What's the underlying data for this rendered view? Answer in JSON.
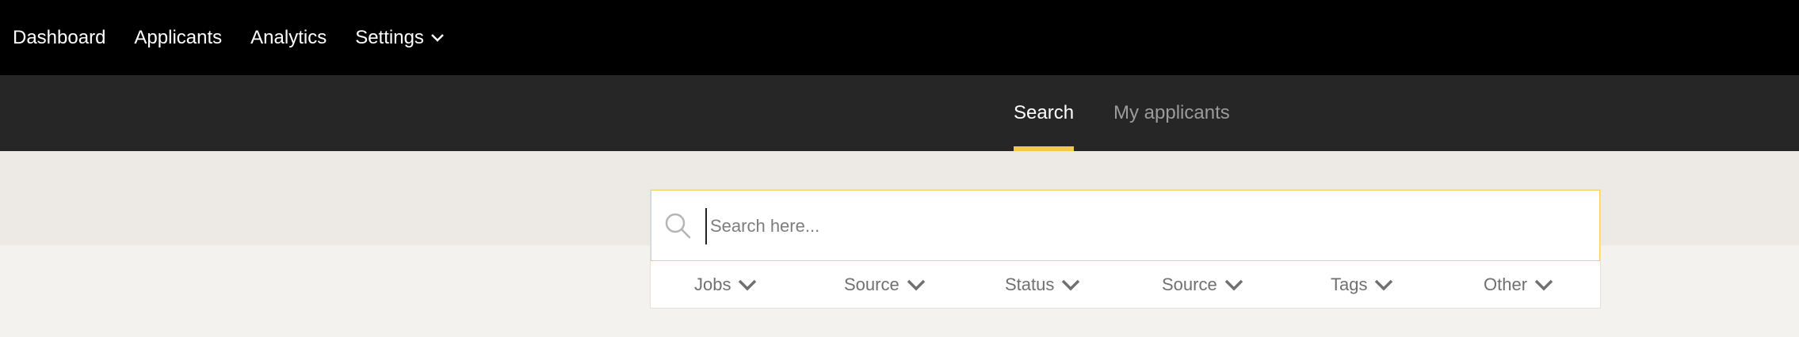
{
  "topnav": {
    "items": [
      {
        "label": "Dashboard"
      },
      {
        "label": "Applicants"
      },
      {
        "label": "Analytics"
      },
      {
        "label": "Settings",
        "icon": "chevron-down-icon"
      }
    ]
  },
  "subnav": {
    "tabs": [
      {
        "label": "Search",
        "active": true
      },
      {
        "label": "My applicants",
        "active": false
      }
    ]
  },
  "search": {
    "placeholder": "Search here...",
    "value": "",
    "icon": "search-icon"
  },
  "filters": [
    {
      "label": "Jobs"
    },
    {
      "label": "Source"
    },
    {
      "label": "Status"
    },
    {
      "label": "Source"
    },
    {
      "label": "Tags"
    },
    {
      "label": "Other"
    }
  ],
  "colors": {
    "topbar": "#000000",
    "subbar": "#262626",
    "accent": "#f2c94c",
    "band": "#edeae5",
    "page": "#f3f2ee"
  }
}
